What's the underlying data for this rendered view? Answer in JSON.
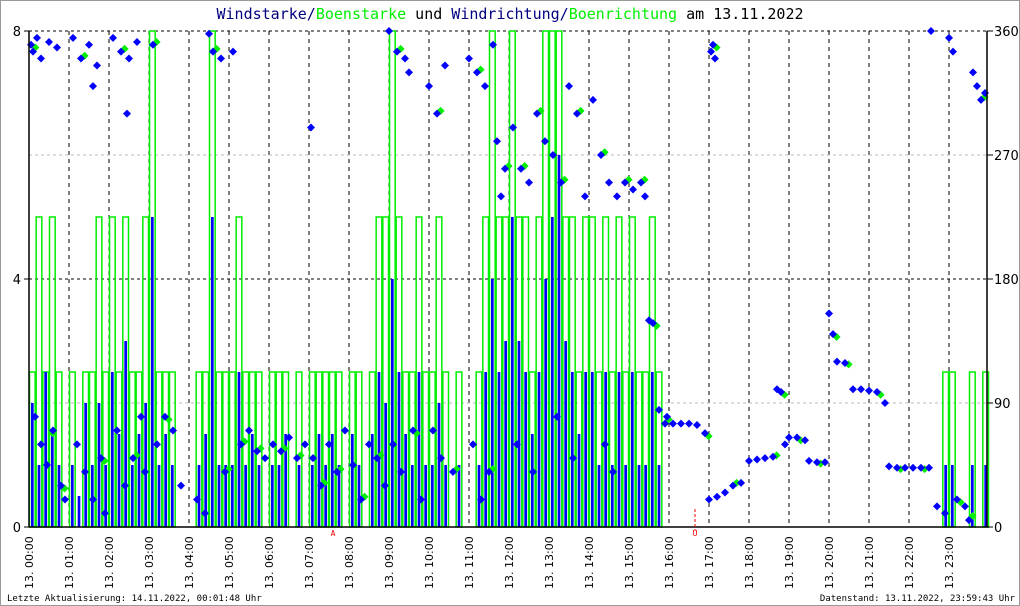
{
  "title": {
    "part1": "Windstarke",
    "sep1": "/",
    "part2": "Boenstarke",
    "mid": " und ",
    "part3": "Windrichtung",
    "sep2": "/",
    "part4": "Boenrichtung",
    "tail": " am 13.11.2022"
  },
  "footer": {
    "left": "Letzte Aktualisierung: 14.11.2022, 00:01:48 Uhr",
    "right": "Datenstand: 13.11.2022, 23:59:43 Uhr"
  },
  "colors": {
    "wind": "#0000ff",
    "gust": "#00ee00",
    "title_dark": "#000080",
    "marker": "#ff0000"
  },
  "chart_data": {
    "type": "bar+scatter",
    "x_unit": "hour of day",
    "xlim": [
      0,
      24
    ],
    "x_tick_labels": [
      "13. 00:00",
      "13. 01:00",
      "13. 02:00",
      "13. 03:00",
      "13. 04:00",
      "13. 05:00",
      "13. 06:00",
      "13. 07:00",
      "13. 08:00",
      "13. 09:00",
      "13. 10:00",
      "13. 11:00",
      "13. 12:00",
      "13. 13:00",
      "13. 14:00",
      "13. 15:00",
      "13. 16:00",
      "13. 17:00",
      "13. 18:00",
      "13. 19:00",
      "13. 20:00",
      "13. 21:00",
      "13. 22:00",
      "13. 23:00"
    ],
    "y_left": {
      "range": [
        0,
        8
      ],
      "ticks": [
        "0",
        "4",
        "8"
      ]
    },
    "y_right": {
      "range": [
        0,
        360
      ],
      "ticks": [
        "0",
        "90",
        "180",
        "270",
        "360"
      ]
    },
    "grid": true,
    "sun_markers": [
      {
        "label": "A",
        "hour": 7.6
      },
      {
        "label": "U",
        "hour": 16.65
      }
    ],
    "bar_interval_minutes": 10,
    "windstarke": [
      2,
      1,
      2.5,
      1.5,
      1,
      0,
      1,
      0.5,
      2,
      1,
      2,
      1,
      2.5,
      1.5,
      3,
      1,
      1.5,
      2,
      5,
      1,
      1.5,
      1,
      0,
      0,
      0,
      1,
      1.5,
      5,
      1,
      1,
      1,
      2.5,
      1,
      1.5,
      1,
      0,
      1,
      1,
      1.5,
      0,
      1,
      0,
      1,
      1.5,
      1,
      1.5,
      1,
      0,
      1.5,
      1,
      0,
      1.5,
      2.5,
      2,
      4,
      2.5,
      1.5,
      1,
      2.5,
      1,
      1,
      2,
      1,
      0,
      1,
      0,
      0,
      1,
      2.5,
      4,
      2.5,
      3,
      5,
      3,
      2.5,
      1.5,
      2.5,
      4,
      5,
      6,
      3,
      2.5,
      1.5,
      2.5,
      2.5,
      1,
      2.5,
      1,
      2.5,
      1,
      2.5,
      1,
      1,
      2.5,
      1,
      0,
      0,
      0,
      0,
      0,
      0,
      0,
      0,
      0,
      0,
      0,
      0,
      0,
      0,
      0,
      0,
      0,
      0,
      0,
      0,
      0,
      0,
      0,
      0,
      0,
      0,
      0,
      0,
      0,
      0,
      0,
      0,
      0,
      0,
      0,
      0,
      0,
      0,
      0,
      0,
      0,
      0,
      1,
      1,
      0,
      0,
      1,
      0,
      1
    ],
    "boenstarke": [
      2.5,
      5,
      2.5,
      5,
      2.5,
      0,
      2.5,
      0,
      2.5,
      2.5,
      5,
      2.5,
      5,
      2.5,
      5,
      2.5,
      2.5,
      5,
      8,
      2.5,
      2.5,
      2.5,
      0,
      0,
      0,
      2.5,
      2.5,
      8,
      2.5,
      2.5,
      2.5,
      5,
      2.5,
      2.5,
      2.5,
      0,
      2.5,
      2.5,
      2.5,
      0,
      2.5,
      0,
      2.5,
      2.5,
      2.5,
      2.5,
      2.5,
      0,
      2.5,
      2.5,
      0,
      2.5,
      5,
      5,
      8,
      5,
      2.5,
      2.5,
      5,
      2.5,
      2.5,
      5,
      2.5,
      0,
      2.5,
      0,
      0,
      2.5,
      5,
      8,
      5,
      5,
      8,
      5,
      5,
      2.5,
      5,
      8,
      8,
      8,
      5,
      5,
      2.5,
      5,
      5,
      2.5,
      5,
      2.5,
      5,
      2.5,
      5,
      2.5,
      2.5,
      5,
      2.5,
      0,
      0,
      0,
      0,
      0,
      0,
      0,
      0,
      0,
      0,
      0,
      0,
      0,
      0,
      0,
      0,
      0,
      0,
      0,
      0,
      0,
      0,
      0,
      0,
      0,
      0,
      0,
      0,
      0,
      0,
      0,
      0,
      0,
      0,
      0,
      0,
      0,
      0,
      0,
      0,
      0,
      0,
      2.5,
      2.5,
      0,
      0,
      2.5,
      0,
      2.5
    ],
    "windrichtung": [
      [
        0.05,
        350
      ],
      [
        0.1,
        345
      ],
      [
        0.2,
        355
      ],
      [
        0.3,
        340
      ],
      [
        0.5,
        352
      ],
      [
        0.7,
        348
      ],
      [
        0.15,
        80
      ],
      [
        0.3,
        60
      ],
      [
        0.45,
        45
      ],
      [
        0.6,
        70
      ],
      [
        0.8,
        30
      ],
      [
        0.9,
        20
      ],
      [
        1.1,
        355
      ],
      [
        1.3,
        340
      ],
      [
        1.5,
        350
      ],
      [
        1.7,
        335
      ],
      [
        1.6,
        320
      ],
      [
        1.2,
        60
      ],
      [
        1.4,
        40
      ],
      [
        1.6,
        20
      ],
      [
        1.8,
        50
      ],
      [
        1.9,
        10
      ],
      [
        2.1,
        355
      ],
      [
        2.3,
        345
      ],
      [
        2.45,
        300
      ],
      [
        2.5,
        340
      ],
      [
        2.7,
        352
      ],
      [
        2.2,
        70
      ],
      [
        2.4,
        30
      ],
      [
        2.6,
        50
      ],
      [
        2.8,
        80
      ],
      [
        2.9,
        40
      ],
      [
        3.1,
        350
      ],
      [
        3.2,
        60
      ],
      [
        3.4,
        80
      ],
      [
        3.6,
        70
      ],
      [
        3.8,
        30
      ],
      [
        4.2,
        20
      ],
      [
        4.4,
        10
      ],
      [
        4.5,
        358
      ],
      [
        4.6,
        345
      ],
      [
        4.8,
        340
      ],
      [
        4.9,
        40
      ],
      [
        5.1,
        345
      ],
      [
        5.3,
        60
      ],
      [
        5.5,
        70
      ],
      [
        5.7,
        55
      ],
      [
        5.9,
        50
      ],
      [
        6.1,
        60
      ],
      [
        6.3,
        55
      ],
      [
        6.5,
        65
      ],
      [
        6.7,
        50
      ],
      [
        6.9,
        60
      ],
      [
        7.05,
        290
      ],
      [
        7.1,
        50
      ],
      [
        7.3,
        30
      ],
      [
        7.5,
        60
      ],
      [
        7.7,
        40
      ],
      [
        7.9,
        70
      ],
      [
        8.1,
        45
      ],
      [
        8.3,
        20
      ],
      [
        8.5,
        60
      ],
      [
        8.7,
        50
      ],
      [
        8.9,
        30
      ],
      [
        9.0,
        360
      ],
      [
        9.2,
        345
      ],
      [
        9.4,
        340
      ],
      [
        9.5,
        330
      ],
      [
        9.1,
        60
      ],
      [
        9.3,
        40
      ],
      [
        9.6,
        70
      ],
      [
        9.8,
        20
      ],
      [
        10.0,
        320
      ],
      [
        10.2,
        300
      ],
      [
        10.4,
        335
      ],
      [
        10.1,
        70
      ],
      [
        10.3,
        50
      ],
      [
        10.6,
        40
      ],
      [
        11.0,
        340
      ],
      [
        11.2,
        330
      ],
      [
        11.4,
        320
      ],
      [
        11.6,
        350
      ],
      [
        11.1,
        60
      ],
      [
        11.3,
        20
      ],
      [
        11.5,
        40
      ],
      [
        11.7,
        280
      ],
      [
        11.9,
        260
      ],
      [
        11.8,
        240
      ],
      [
        12.1,
        290
      ],
      [
        12.3,
        260
      ],
      [
        12.5,
        250
      ],
      [
        12.7,
        300
      ],
      [
        12.9,
        280
      ],
      [
        12.2,
        60
      ],
      [
        12.6,
        40
      ],
      [
        13.1,
        270
      ],
      [
        13.3,
        250
      ],
      [
        13.5,
        320
      ],
      [
        13.7,
        300
      ],
      [
        13.9,
        240
      ],
      [
        13.2,
        80
      ],
      [
        13.6,
        50
      ],
      [
        14.1,
        310
      ],
      [
        14.3,
        270
      ],
      [
        14.5,
        250
      ],
      [
        14.7,
        240
      ],
      [
        14.9,
        250
      ],
      [
        14.4,
        60
      ],
      [
        14.6,
        40
      ],
      [
        15.1,
        245
      ],
      [
        15.3,
        250
      ],
      [
        15.4,
        240
      ],
      [
        15.5,
        150
      ],
      [
        15.6,
        148
      ],
      [
        15.75,
        85
      ],
      [
        15.9,
        75
      ],
      [
        15.95,
        80
      ],
      [
        16.1,
        75
      ],
      [
        16.3,
        75
      ],
      [
        16.5,
        75
      ],
      [
        16.7,
        74
      ],
      [
        16.9,
        68
      ],
      [
        17.0,
        20
      ],
      [
        17.05,
        345
      ],
      [
        17.1,
        350
      ],
      [
        17.15,
        340
      ],
      [
        17.2,
        22
      ],
      [
        17.4,
        25
      ],
      [
        17.6,
        30
      ],
      [
        17.8,
        32
      ],
      [
        18.0,
        48
      ],
      [
        18.2,
        49
      ],
      [
        18.4,
        50
      ],
      [
        18.6,
        51
      ],
      [
        18.7,
        100
      ],
      [
        18.8,
        98
      ],
      [
        18.9,
        60
      ],
      [
        19.0,
        65
      ],
      [
        19.2,
        65
      ],
      [
        19.4,
        63
      ],
      [
        19.5,
        48
      ],
      [
        19.7,
        47
      ],
      [
        19.9,
        47
      ],
      [
        20.0,
        155
      ],
      [
        20.1,
        140
      ],
      [
        20.2,
        120
      ],
      [
        20.4,
        119
      ],
      [
        20.6,
        100
      ],
      [
        20.8,
        100
      ],
      [
        21.0,
        99
      ],
      [
        21.2,
        98
      ],
      [
        21.4,
        90
      ],
      [
        21.5,
        44
      ],
      [
        21.7,
        43
      ],
      [
        21.9,
        43
      ],
      [
        22.1,
        43
      ],
      [
        22.3,
        43
      ],
      [
        22.5,
        43
      ],
      [
        22.55,
        360
      ],
      [
        22.7,
        15
      ],
      [
        22.9,
        10
      ],
      [
        23.0,
        355
      ],
      [
        23.1,
        345
      ],
      [
        23.2,
        20
      ],
      [
        23.4,
        15
      ],
      [
        23.5,
        5
      ],
      [
        23.6,
        330
      ],
      [
        23.7,
        320
      ],
      [
        23.8,
        310
      ],
      [
        23.9,
        315
      ]
    ],
    "boenrichtung": [
      [
        0.12,
        348
      ],
      [
        0.55,
        68
      ],
      [
        0.85,
        28
      ],
      [
        1.35,
        342
      ],
      [
        1.85,
        48
      ],
      [
        2.35,
        347
      ],
      [
        2.65,
        52
      ],
      [
        3.15,
        352
      ],
      [
        3.45,
        78
      ],
      [
        4.65,
        347
      ],
      [
        4.95,
        42
      ],
      [
        5.35,
        62
      ],
      [
        5.75,
        57
      ],
      [
        6.35,
        57
      ],
      [
        6.75,
        52
      ],
      [
        7.35,
        32
      ],
      [
        7.75,
        42
      ],
      [
        8.35,
        22
      ],
      [
        8.75,
        52
      ],
      [
        9.25,
        347
      ],
      [
        9.65,
        68
      ],
      [
        10.25,
        302
      ],
      [
        10.65,
        42
      ],
      [
        11.25,
        332
      ],
      [
        11.55,
        42
      ],
      [
        11.95,
        262
      ],
      [
        12.35,
        262
      ],
      [
        12.75,
        302
      ],
      [
        13.35,
        252
      ],
      [
        13.75,
        302
      ],
      [
        14.35,
        272
      ],
      [
        14.95,
        252
      ],
      [
        15.35,
        252
      ],
      [
        15.65,
        146
      ],
      [
        15.95,
        78
      ],
      [
        16.95,
        66
      ],
      [
        17.15,
        348
      ],
      [
        17.65,
        32
      ],
      [
        18.65,
        52
      ],
      [
        18.85,
        96
      ],
      [
        19.25,
        63
      ],
      [
        19.75,
        46
      ],
      [
        20.15,
        138
      ],
      [
        20.45,
        118
      ],
      [
        21.25,
        96
      ],
      [
        21.75,
        42
      ],
      [
        22.35,
        42
      ],
      [
        23.25,
        18
      ],
      [
        23.55,
        8
      ],
      [
        23.85,
        312
      ]
    ]
  }
}
